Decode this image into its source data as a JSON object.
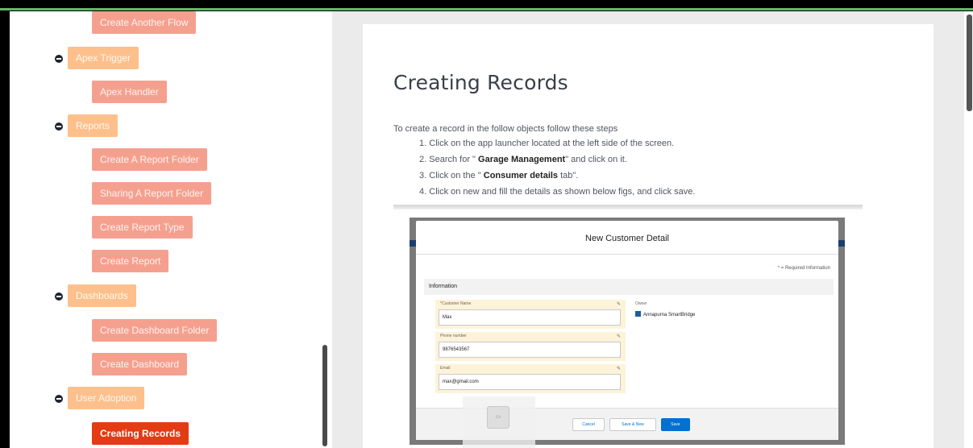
{
  "sidebar": {
    "items": [
      {
        "label": "Create Another Flow",
        "level": 2
      },
      {
        "label": "Apex Trigger",
        "level": 1
      },
      {
        "label": "Apex Handler",
        "level": 2
      },
      {
        "label": "Reports",
        "level": 1
      },
      {
        "label": "Create A Report Folder",
        "level": 2
      },
      {
        "label": "Sharing A Report Folder",
        "level": 2
      },
      {
        "label": "Create Report Type",
        "level": 2
      },
      {
        "label": "Create Report",
        "level": 2
      },
      {
        "label": "Dashboards",
        "level": 1
      },
      {
        "label": "Create Dashboard Folder",
        "level": 2
      },
      {
        "label": "Create Dashboard",
        "level": 2
      },
      {
        "label": "User Adoption",
        "level": 1
      },
      {
        "label": "Creating Records",
        "level": 2,
        "active": true
      }
    ]
  },
  "content": {
    "title": "Creating Records",
    "intro": "To create a record in the follow objects follow these steps",
    "steps": [
      {
        "num": "1.",
        "pre": "Click on the app launcher located at the left side of the screen.",
        "bold": "",
        "post": ""
      },
      {
        "num": "2.",
        "pre": "Search for \" ",
        "bold": "Garage Management",
        "post": "\" and click on it."
      },
      {
        "num": "3.",
        "pre": "Click on the \" ",
        "bold": "Consumer details ",
        "post": "tab\"."
      },
      {
        "num": "4.",
        "pre": "Click on new and fill the details as shown below figs, and click save.",
        "bold": "",
        "post": ""
      }
    ]
  },
  "figure": {
    "modal_title": "New Customer Detail",
    "required_note": "= Required Information",
    "section": "Information",
    "fields": [
      {
        "label": "Customer Name",
        "required": true,
        "value": "Max"
      },
      {
        "label": "Phone number",
        "required": false,
        "value": "9876543567"
      },
      {
        "label": "Email",
        "required": false,
        "value": "max@gmail.com"
      }
    ],
    "owner_label": "Owner",
    "owner_value": "Annapurna SmartBridge",
    "buttons": {
      "cancel": "Cancel",
      "save_new": "Save & New",
      "save": "Save"
    }
  },
  "colors": {
    "accent_top": "#5fb86a",
    "pill_level1": "#fdc08c",
    "pill_level2": "#f5a08f",
    "pill_active": "#e33b14"
  }
}
